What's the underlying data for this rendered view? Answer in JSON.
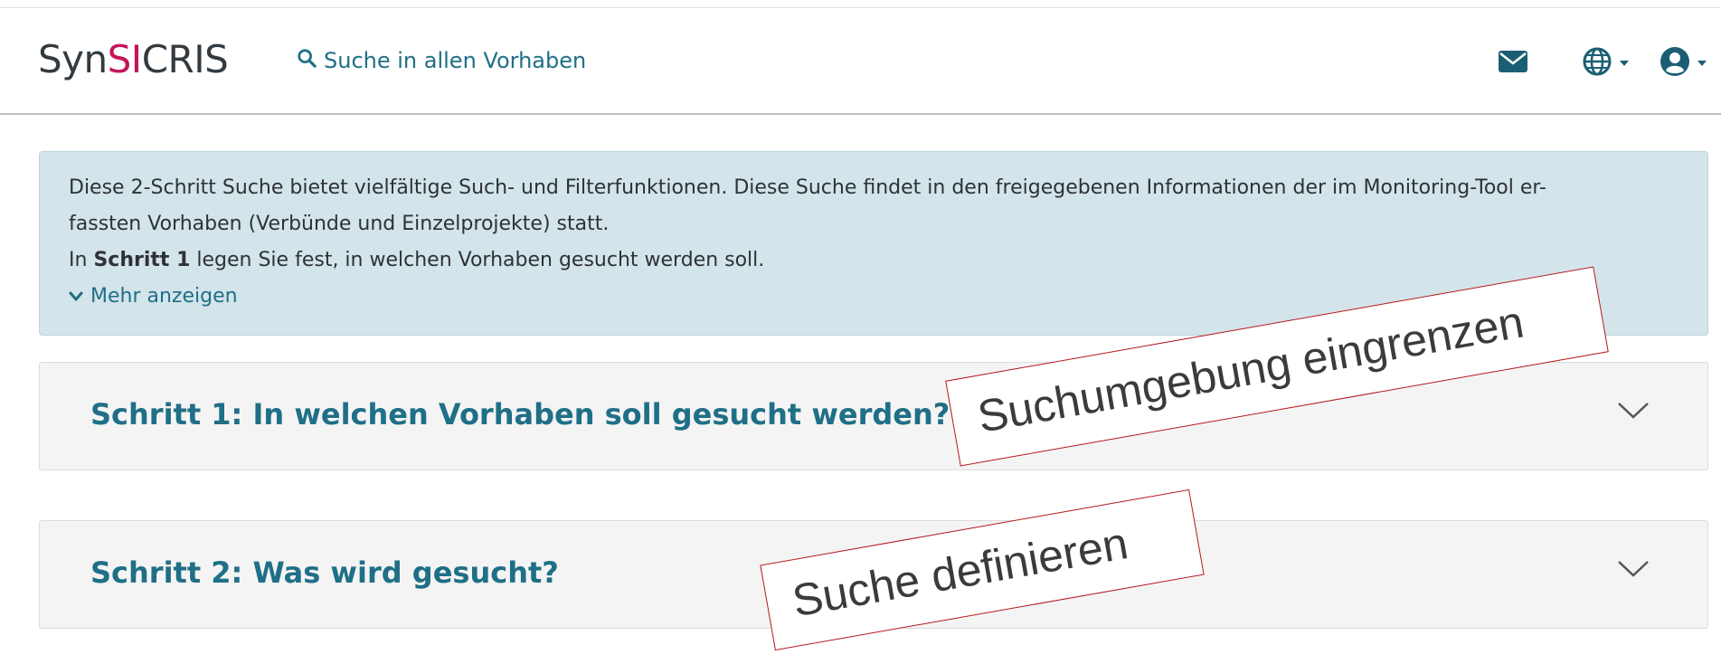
{
  "navbar": {
    "brand_prefix": "Syn",
    "brand_highlight": "SI",
    "brand_suffix": "CRIS",
    "search_link": "Suche in allen Vorhaben",
    "icons": [
      "envelope-icon",
      "globe-icon",
      "user-circle-icon"
    ],
    "colors": {
      "brand_highlight": "#c4145a",
      "link": "#1f6f87",
      "icon": "#1b5e74"
    }
  },
  "info": {
    "line1": "Diese 2-Schritt Suche bietet vielfältige Such- und Filterfunktionen. Diese Suche findet in den freigegebenen Informationen der im Monitoring-Tool er-",
    "line2": "fassten Vorhaben (Verbünde und Einzelprojekte) statt.",
    "line3_pre": "In ",
    "line3_bold": "Schritt 1",
    "line3_post": " legen Sie fest, in welchen Vorhaben gesucht werden soll.",
    "more_label": "Mehr anzeigen",
    "colors": {
      "background": "#d3e4ea"
    }
  },
  "steps": [
    {
      "title": "Schritt 1: In welchen Vorhaben soll gesucht werden?"
    },
    {
      "title": "Schritt 2: Was wird gesucht?"
    }
  ],
  "annotations": [
    {
      "text": "Suchumgebung eingrenzen"
    },
    {
      "text": "Suche definieren"
    }
  ]
}
